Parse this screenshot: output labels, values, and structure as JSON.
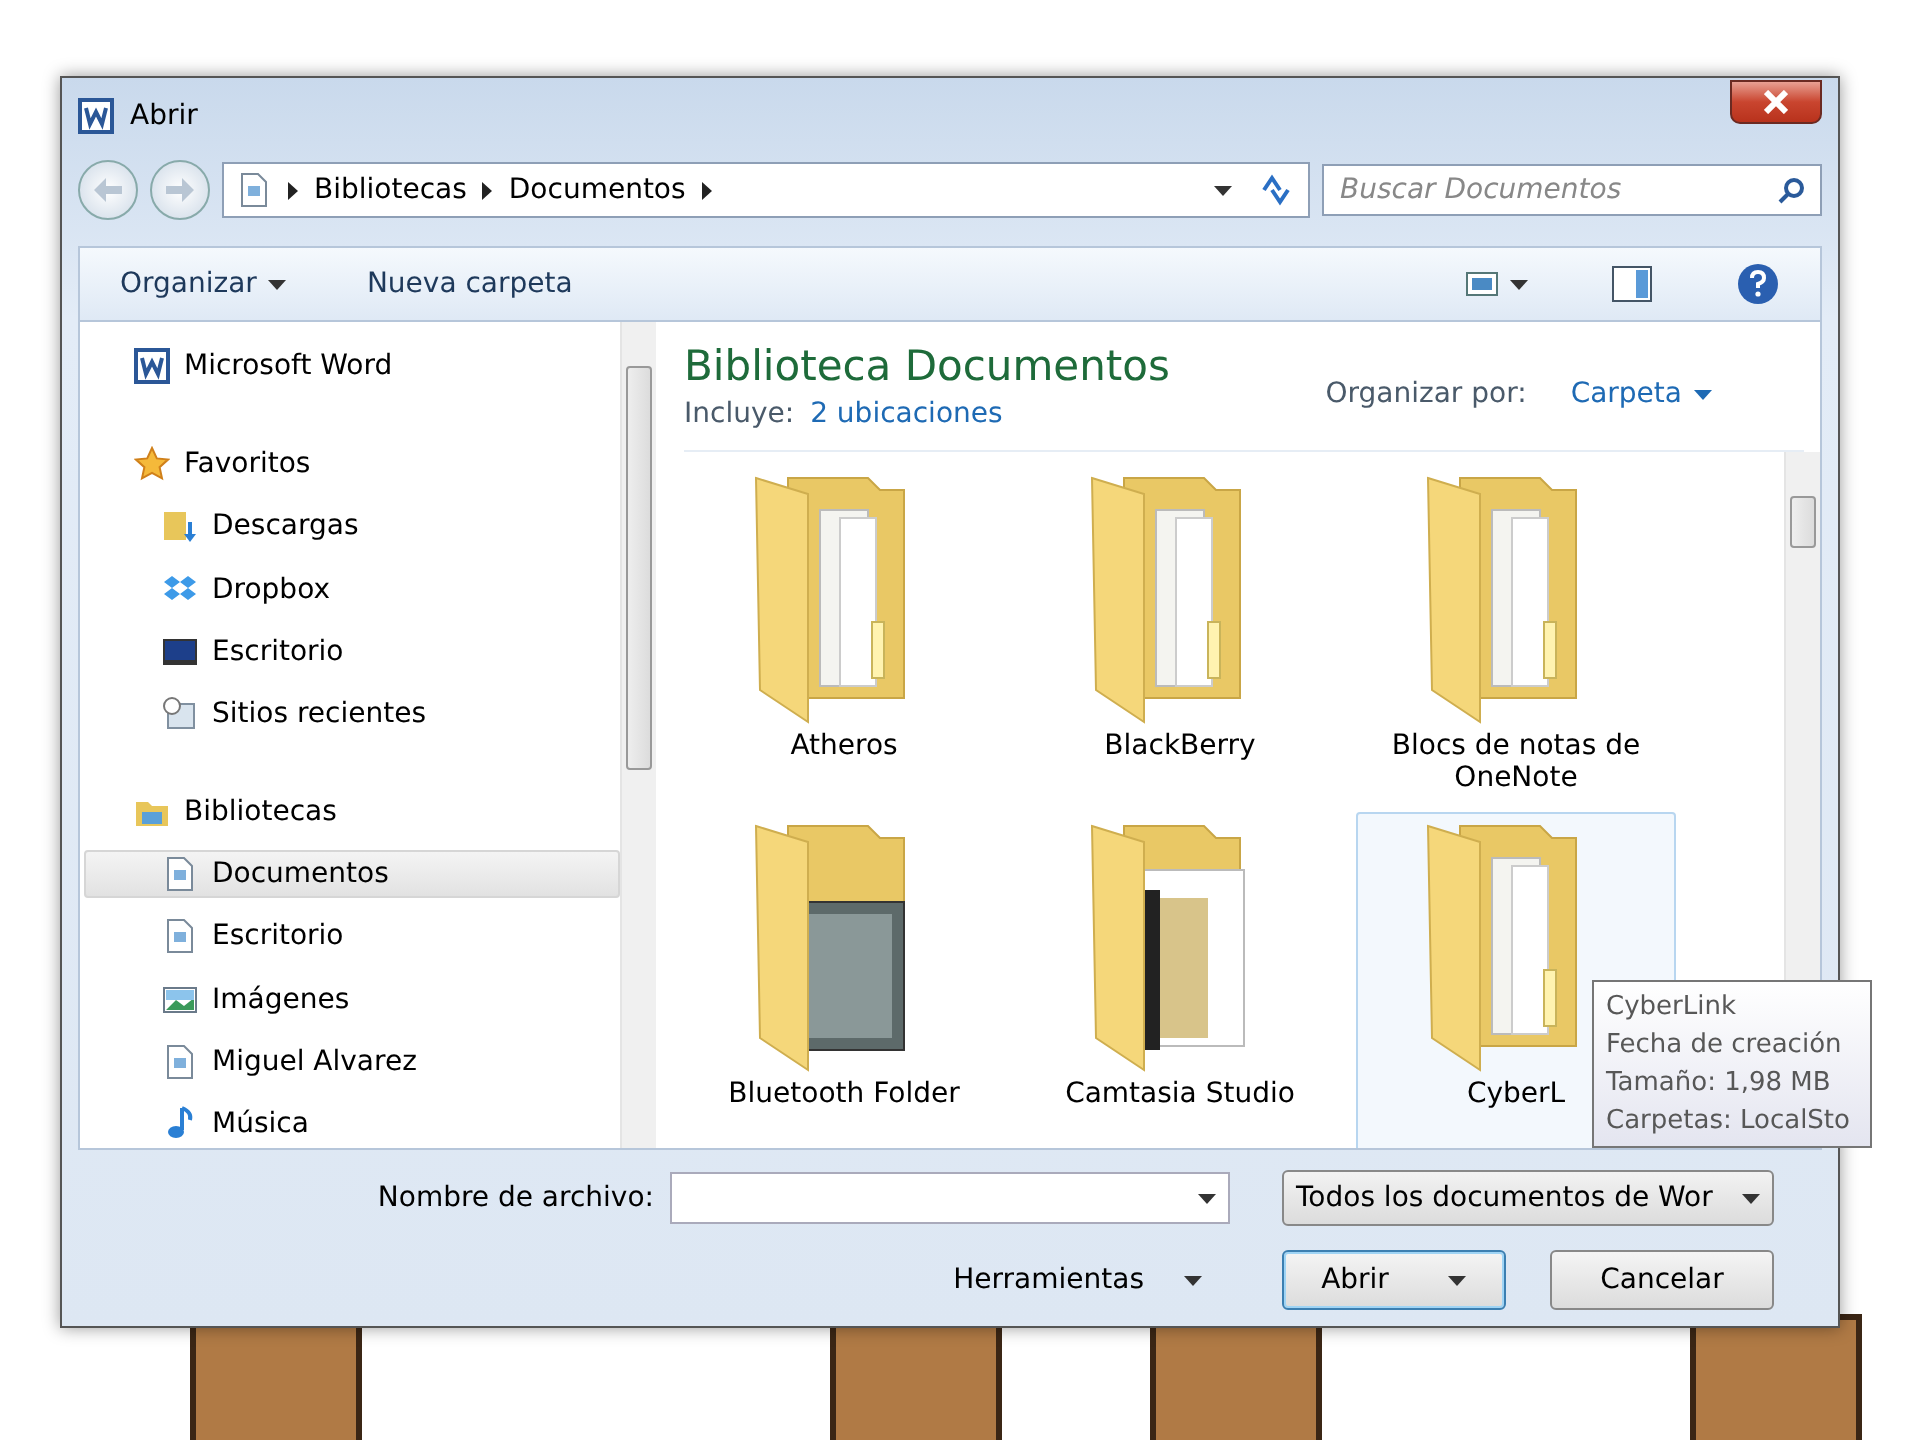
{
  "window": {
    "title": "Abrir"
  },
  "address": {
    "crumbs": [
      "Bibliotecas",
      "Documentos"
    ]
  },
  "search": {
    "placeholder": "Buscar Documentos"
  },
  "toolbar": {
    "organize": "Organizar",
    "new_folder": "Nueva carpeta"
  },
  "nav": [
    {
      "label": "Microsoft Word",
      "kind": "word",
      "selected": false
    },
    {
      "label": "Favoritos",
      "kind": "star",
      "selected": false,
      "children": [
        {
          "label": "Descargas",
          "kind": "download",
          "selected": false
        },
        {
          "label": "Dropbox",
          "kind": "dropbox",
          "selected": false
        },
        {
          "label": "Escritorio",
          "kind": "desktop",
          "selected": false
        },
        {
          "label": "Sitios recientes",
          "kind": "recent",
          "selected": false
        }
      ]
    },
    {
      "label": "Bibliotecas",
      "kind": "library",
      "selected": false,
      "children": [
        {
          "label": "Documentos",
          "kind": "document",
          "selected": true
        },
        {
          "label": "Escritorio",
          "kind": "document",
          "selected": false
        },
        {
          "label": "Imágenes",
          "kind": "image",
          "selected": false
        },
        {
          "label": "Miguel Alvarez",
          "kind": "document",
          "selected": false
        },
        {
          "label": "Música",
          "kind": "music",
          "selected": false
        }
      ]
    }
  ],
  "library": {
    "title": "Biblioteca Documentos",
    "includes_label": "Incluye:",
    "includes_link": "2 ubicaciones",
    "arrange_label": "Organizar por:",
    "arrange_value": "Carpeta"
  },
  "folders": [
    {
      "name": "Atheros",
      "kind": "documents",
      "hovered": false
    },
    {
      "name": "BlackBerry",
      "kind": "documents",
      "hovered": false
    },
    {
      "name": "Blocs de notas de OneNote",
      "kind": "documents",
      "hovered": false
    },
    {
      "name": "Bluetooth Folder",
      "kind": "bluetooth",
      "hovered": false
    },
    {
      "name": "Camtasia Studio",
      "kind": "media",
      "hovered": false
    },
    {
      "name": "CyberL",
      "kind": "documents",
      "hovered": true
    }
  ],
  "tooltip": [
    "CyberLink",
    "Fecha de creación",
    "Tamaño: 1,98 MB",
    "Carpetas: LocalSto"
  ],
  "footer": {
    "filename_label": "Nombre de archivo:",
    "filter": "Todos los documentos de Wor",
    "tools": "Herramientas",
    "open": "Abrir",
    "cancel": "Cancelar"
  }
}
